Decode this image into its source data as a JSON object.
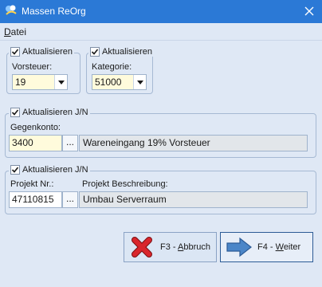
{
  "window": {
    "title": "Massen ReOrg",
    "close_icon": "close-icon",
    "app_icon": "app-icon"
  },
  "menu": {
    "items": [
      {
        "prefix": "D",
        "rest": "atei"
      }
    ]
  },
  "vorsteuer_group": {
    "checkbox_label": "Aktualisieren",
    "checked": true,
    "field_label": "Vorsteuer:",
    "value": "19"
  },
  "kategorie_group": {
    "checkbox_label": "Aktualisieren",
    "checked": true,
    "field_label": "Kategorie:",
    "value": "51000"
  },
  "gegenkonto_group": {
    "checkbox_label": "Aktualisieren J/N",
    "checked": true,
    "field_label": "Gegenkonto:",
    "value": "3400",
    "lookup_label": "...",
    "description": "Wareneingang 19% Vorsteuer"
  },
  "projekt_group": {
    "checkbox_label": "Aktualisieren J/N",
    "checked": true,
    "nr_label": "Projekt Nr.:",
    "nr_value": "47110815",
    "lookup_label": "...",
    "desc_label": "Projekt Beschreibung:",
    "desc_value": "Umbau Serverraum"
  },
  "buttons": {
    "cancel": {
      "prefix": "F3 - ",
      "hotkey": "A",
      "rest": "bbruch",
      "icon": "red-x-icon",
      "color": "#d9262c"
    },
    "next": {
      "prefix": "F4 - ",
      "hotkey": "W",
      "rest": "eiter",
      "icon": "arrow-right-icon",
      "color": "#4b86c8"
    }
  },
  "colors": {
    "titlebar": "#2b79d6",
    "background": "#dfe8f5",
    "input_highlight": "#fffbdc"
  }
}
